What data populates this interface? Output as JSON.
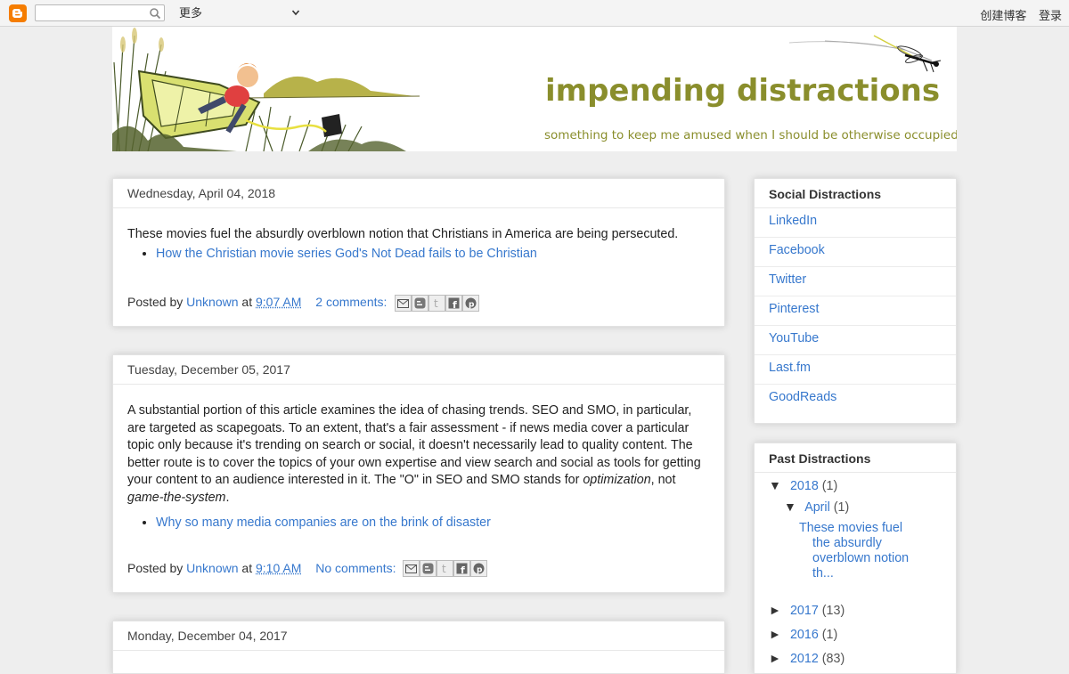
{
  "navbar": {
    "more_label": "更多",
    "create_blog": "创建博客",
    "login": "登录"
  },
  "header": {
    "title": "impending distractions",
    "tagline": "something to keep me amused when I should be otherwise occupied"
  },
  "posts": [
    {
      "date": "Wednesday, April 04, 2018",
      "body": "These movies fuel the absurdly overblown notion that Christians in America are being persecuted.",
      "link": "How the Christian movie series God's Not Dead fails to be Christian",
      "posted_by": "Posted by",
      "author": "Unknown",
      "at": "at",
      "time": "9:07 AM",
      "comments": "2 comments:"
    },
    {
      "date": "Tuesday, December 05, 2017",
      "body_parts": [
        "A substantial portion of this article examines the idea of chasing trends. SEO and SMO, in particular, are targeted as scapegoats. To an extent, that's a fair assessment - if news media cover a particular topic only because it's trending on search or social, it doesn't necessarily lead to quality content. The better route is to cover the topics of your own expertise and view search and social as tools for getting your content to an audience interested in it. The \"O\" in SEO and SMO stands for ",
        "optimization",
        ", not ",
        "game-the-system",
        "."
      ],
      "link": "Why so many media companies are on the brink of disaster",
      "posted_by": "Posted by",
      "author": "Unknown",
      "at": "at",
      "time": "9:10 AM",
      "comments": "No comments:"
    },
    {
      "date": "Monday, December 04, 2017"
    }
  ],
  "sidebar": {
    "social": {
      "title": "Social Distractions",
      "links": [
        "LinkedIn",
        "Facebook",
        "Twitter",
        "Pinterest",
        "YouTube",
        "Last.fm",
        "GoodReads"
      ]
    },
    "archive": {
      "title": "Past Distractions",
      "open_marker": "▼",
      "closed_marker": "►",
      "year_2018": "2018",
      "year_2018_count": "(1)",
      "month_april": "April",
      "month_april_count": "(1)",
      "april_post": "These movies fuel the absurdly overblown notion th...",
      "year_2017": "2017",
      "year_2017_count": "(13)",
      "year_2016": "2016",
      "year_2016_count": "(1)",
      "year_2012": "2012",
      "year_2012_count": "(83)"
    }
  },
  "colors": {
    "link": "#3778cd",
    "title": "#8a8e2c",
    "background": "#eeeeee",
    "blogger_orange": "#f57d00"
  }
}
